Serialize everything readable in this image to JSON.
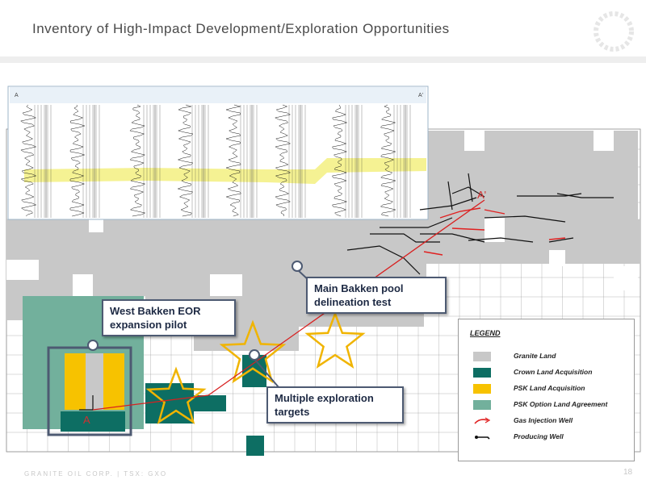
{
  "slide": {
    "title": "Inventory of High-Impact Development/Exploration Opportunities",
    "footer": "GRANITE OIL CORP. | TSX: GXO",
    "page_number": "18"
  },
  "cross_section": {
    "left_label": "A",
    "right_label": "A'"
  },
  "map_labels": {
    "section_a": "A",
    "section_a_prime": "A'"
  },
  "callouts": {
    "west_bakken": "West Bakken EOR expansion pilot",
    "main_bakken": "Main Bakken pool delineation test",
    "exploration": "Multiple exploration targets"
  },
  "legend": {
    "title": "LEGEND",
    "items": [
      {
        "label": "Granite Land",
        "color": "#c8c8c8"
      },
      {
        "label": "Crown Land Acquisition",
        "color": "#0d6e63"
      },
      {
        "label": "PSK Land Acquisition",
        "color": "#f7c200"
      },
      {
        "label": "PSK Option Land Agreement",
        "color": "#72b09c"
      },
      {
        "label": "Gas Injection Well",
        "color": "#e02020"
      },
      {
        "label": "Producing Well",
        "color": "#111111"
      }
    ]
  }
}
